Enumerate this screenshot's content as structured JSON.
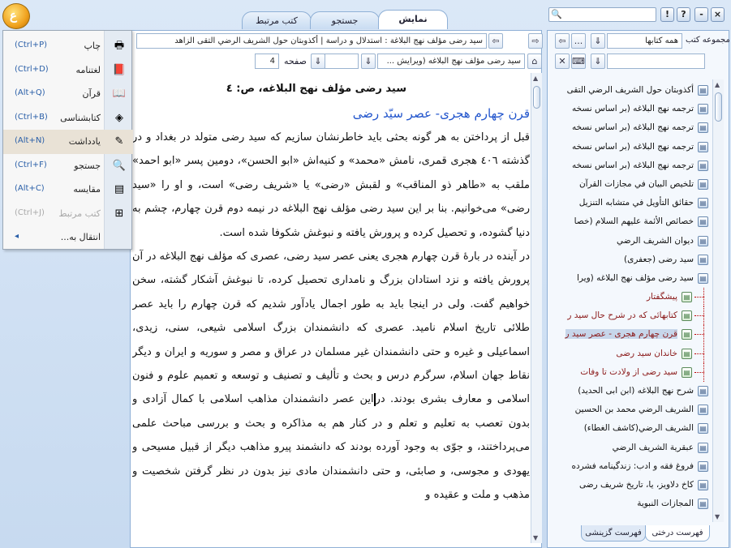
{
  "app": {
    "logo_text": "ع"
  },
  "tabs": [
    {
      "label": "نمایش",
      "active": true
    },
    {
      "label": "جستجو",
      "active": false
    },
    {
      "label": "کتب مرتبط",
      "active": false
    }
  ],
  "window_buttons": [
    "!",
    "?",
    "-",
    "×"
  ],
  "main_toolbar": {
    "breadcrumb": "سید رضی مؤلف نهج البلاغة : استدلال و دراسة  |  أكذوبتان حول الشريف الرضي التقى الزاهد",
    "book_select": "سید رضی مؤلف نهج البلاغه (ویرایش ...",
    "page_label": "صفحه",
    "page_value": "4"
  },
  "right_toolbar": {
    "collection_label": "مجموعه کتب",
    "collection_value": "همه کتابها",
    "ellipsis": "..."
  },
  "document": {
    "header": "سيد رضى مؤلف نهج البلاغه، ص: ٤",
    "subtitle": "قرن چهارم هجرى- عصر سيّد رضى",
    "paragraph1": "قبل از پرداختن به هر گونه بحثى بايد خاطرنشان سازيم كه سيد رضى متولد در بغداد و در گذشته ٤٠٦ هجرى قمرى، نامش «محمد» و كنيه‌اش «ابو الحسن»، دومين پسر «ابو احمد» ملقب به «طاهر ذو المناقب» و لقبش «رضى» يا «شريف رضى» است، و او را «سيد رضى» مى‌خوانيم. بنا بر اين سيد رضى مؤلف نهج البلاغه در نيمه دوم قرن چهارم، چشم به دنيا گشوده، و تحصيل كرده و پرورش يافته و نبوغش شكوفا شده است.",
    "paragraph2_a": "در آينده در بارۀ قرن چهارم هجرى يعنى عصر سيد رضى، عصرى كه مؤلف نهج البلاغه در آن پرورش يافته و نزد استادان بزرگ و نامدارى تحصيل كرده، تا نبوغش آشكار گشته، سخن خواهيم گفت. ولى در اينجا بايد به طور اجمال يادآور شديم كه قرن چهارم را بايد عصر طلائى تاريخ اسلام ناميد. عصرى كه دانشمندان بزرگ اسلامى شيعى، سنى، زيدى، اسماعيلى و غيره و حتى دانشمندان غير مسلمان در عراق و مصر و سوريه و ايران و ديگر نقاط جهان اسلام، سرگرم درس و بحث و تأليف و تصنيف و توسعه و تعميم علوم و فنون اسلامى و معارف بشرى بودند. در",
    "paragraph2_b": "اين عصر دانشمندان مذاهب اسلامى با كمال آزادى و بدون تعصب به تعليم و تعلم و در كنار هم به مذاكره و بحث و بررسى مباحث علمى مى‌پرداختند، و جوّى به وجود آورده بودند كه دانشمند پيرو مذاهب ديگر از قبيل مسيحى و يهودى و مجوسى، و صابئى، و حتى دانشمندان مادى نيز بدون در نظر گرفتن شخصيت و مذهب و ملت و عقيده و"
  },
  "menu": [
    {
      "label": "چاپ",
      "shortcut": "(Ctrl+P)",
      "icon": "print-icon",
      "glyph": "🖶",
      "state": "normal"
    },
    {
      "label": "لغتنامه",
      "shortcut": "(Ctrl+D)",
      "icon": "dictionary-icon",
      "glyph": "📕",
      "state": "normal"
    },
    {
      "label": "قرآن",
      "shortcut": "(Alt+Q)",
      "icon": "quran-icon",
      "glyph": "📖",
      "state": "normal"
    },
    {
      "label": "کتابشناسی",
      "shortcut": "(Ctrl+B)",
      "icon": "bibliography-icon",
      "glyph": "◈",
      "state": "normal"
    },
    {
      "label": "یادداشت",
      "shortcut": "(Alt+N)",
      "icon": "note-icon",
      "glyph": "✎",
      "state": "hover"
    },
    {
      "label": "جستجو",
      "shortcut": "(Ctrl+F)",
      "icon": "search-icon",
      "glyph": "🔍",
      "state": "normal"
    },
    {
      "label": "مقایسه",
      "shortcut": "(Alt+C)",
      "icon": "compare-icon",
      "glyph": "▤",
      "state": "normal"
    },
    {
      "label": "کتب مرتبط",
      "shortcut": "(Ctrl+J)",
      "icon": "related-books-icon",
      "glyph": "⊞",
      "state": "disabled"
    },
    {
      "label": "انتقال به...",
      "shortcut": "◂",
      "icon": "move-icon",
      "glyph": "",
      "state": "normal"
    }
  ],
  "tree": [
    {
      "label": "أكذوبتان حول الشريف الرضي التقى",
      "level": 0
    },
    {
      "label": "ترجمه نهج البلاغه (بر اساس نسخه",
      "level": 0
    },
    {
      "label": "ترجمه نهج البلاغه (بر اساس نسخه",
      "level": 0
    },
    {
      "label": "ترجمه نهج البلاغه (بر اساس نسخه",
      "level": 0
    },
    {
      "label": "ترجمه نهج البلاغه (بر اساس نسخه",
      "level": 0
    },
    {
      "label": "تلخيص البيان في مجازات القرآن",
      "level": 0
    },
    {
      "label": "حقائق التأويل في متشابه التنزيل",
      "level": 0
    },
    {
      "label": "خصائص الأئمة عليهم السلام (خصا",
      "level": 0
    },
    {
      "label": "ديوان الشريف الرضي",
      "level": 0
    },
    {
      "label": "سيد رضى (جعفرى)",
      "level": 0
    },
    {
      "label": "سيد رضى مؤلف نهج البلاغه (ويرا",
      "level": 0
    },
    {
      "label": "پيشگفتار",
      "level": 1
    },
    {
      "label": "كتابهائى كه در شرح حال سيد ر",
      "level": 1
    },
    {
      "label": "قرن چهارم هجرى - عصر سيد ر",
      "level": 1,
      "selected": true
    },
    {
      "label": "خاندان سيد رضى",
      "level": 1
    },
    {
      "label": "سيد رضى از ولادت تا وفات",
      "level": 1
    },
    {
      "label": "شرح نهج البلاغه (ابن ابى الحديد)",
      "level": 0
    },
    {
      "label": "الشريف الرضي محمد بن الحسين",
      "level": 0
    },
    {
      "label": "الشريف الرضي(كاشف الغطاء)",
      "level": 0
    },
    {
      "label": "عبقرية الشريف الرضي",
      "level": 0
    },
    {
      "label": "فروغ فقه و ادب: زندگينامه فشرده",
      "level": 0
    },
    {
      "label": "كاخ دلاويز، يا، تاريخ شريف رضى",
      "level": 0
    },
    {
      "label": "المجازات النبوية",
      "level": 0
    }
  ],
  "bottom_tabs": [
    {
      "label": "فهرست درختی",
      "active": true
    },
    {
      "label": "فهرست گزینشی",
      "active": false
    }
  ]
}
